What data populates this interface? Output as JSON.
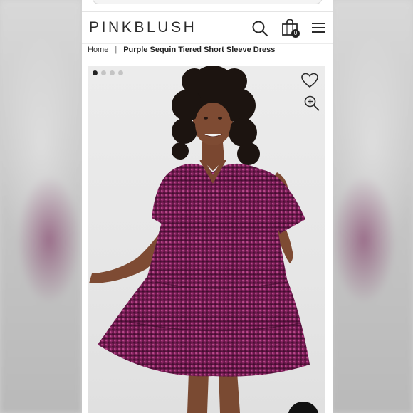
{
  "brand": {
    "logo_text": "PINKBLUSH"
  },
  "header": {
    "icons": [
      "search-icon",
      "shopping-bag-icon",
      "hamburger-menu-icon"
    ],
    "cart_count": "0"
  },
  "breadcrumb": {
    "home_label": "Home",
    "separator": "|",
    "current_label": "Purple Sequin Tiered Short Sleeve Dress"
  },
  "gallery": {
    "image_count": 4,
    "active_index": 0,
    "icons": [
      "heart-icon",
      "zoom-in-icon",
      "chat-icon"
    ]
  },
  "colors": {
    "dress": "#6b1a4a",
    "background": "#e8e8e8",
    "text": "#2b2b2b"
  }
}
